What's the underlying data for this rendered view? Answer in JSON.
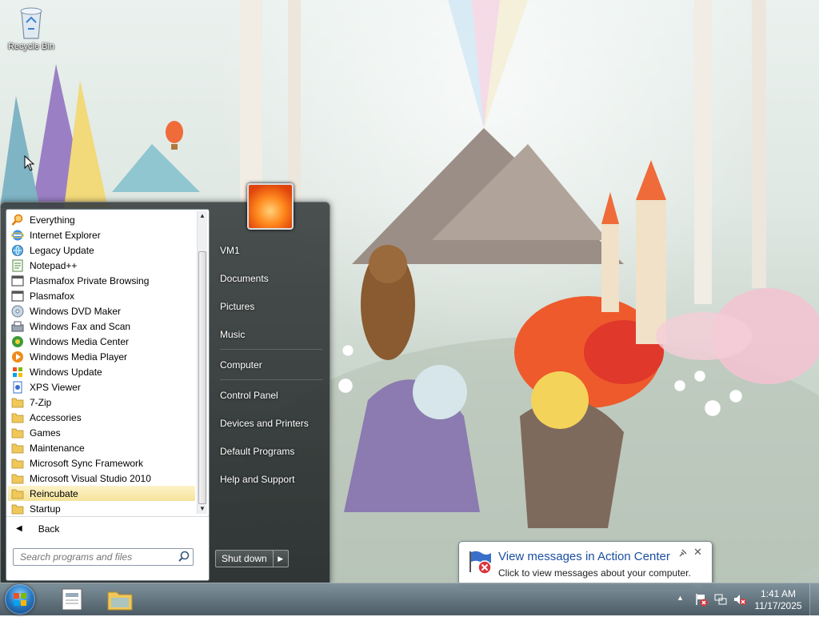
{
  "desktop": {
    "icons": [
      {
        "label": "Recycle Bin",
        "icon": "recycle-bin-icon"
      }
    ]
  },
  "start_menu": {
    "programs": [
      {
        "label": "Everything",
        "icon": "search-magnifier-icon"
      },
      {
        "label": "Internet Explorer",
        "icon": "internet-explorer-icon"
      },
      {
        "label": "Legacy Update",
        "icon": "globe-update-icon"
      },
      {
        "label": "Notepad++",
        "icon": "notepad-icon"
      },
      {
        "label": "Plasmafox Private Browsing",
        "icon": "browser-window-icon"
      },
      {
        "label": "Plasmafox",
        "icon": "browser-window-icon"
      },
      {
        "label": "Windows DVD Maker",
        "icon": "dvd-icon"
      },
      {
        "label": "Windows Fax and Scan",
        "icon": "fax-icon"
      },
      {
        "label": "Windows Media Center",
        "icon": "media-center-icon"
      },
      {
        "label": "Windows Media Player",
        "icon": "media-player-icon"
      },
      {
        "label": "Windows Update",
        "icon": "windows-update-icon"
      },
      {
        "label": "XPS Viewer",
        "icon": "xps-viewer-icon"
      },
      {
        "label": "7-Zip",
        "icon": "folder-icon"
      },
      {
        "label": "Accessories",
        "icon": "folder-icon"
      },
      {
        "label": "Games",
        "icon": "folder-icon"
      },
      {
        "label": "Maintenance",
        "icon": "folder-icon"
      },
      {
        "label": "Microsoft Sync Framework",
        "icon": "folder-icon"
      },
      {
        "label": "Microsoft Visual Studio 2010",
        "icon": "folder-icon"
      },
      {
        "label": "Reincubate",
        "icon": "folder-icon",
        "highlighted": true
      },
      {
        "label": "Startup",
        "icon": "folder-icon"
      }
    ],
    "back_label": "Back",
    "search_placeholder": "Search programs and files",
    "right_items": {
      "user": "VM1",
      "documents": "Documents",
      "pictures": "Pictures",
      "music": "Music",
      "computer": "Computer",
      "control_panel": "Control Panel",
      "devices_printers": "Devices and Printers",
      "default_programs": "Default Programs",
      "help_support": "Help and Support"
    },
    "shutdown_label": "Shut down"
  },
  "balloon": {
    "title": "View messages in Action Center",
    "text": "Click to view messages about your computer."
  },
  "taskbar": {
    "clock_time": "1:41 AM",
    "clock_date": "11/17/2025"
  },
  "colors": {
    "highlight": "#f6e39a",
    "balloon_title": "#1a4fa0"
  }
}
